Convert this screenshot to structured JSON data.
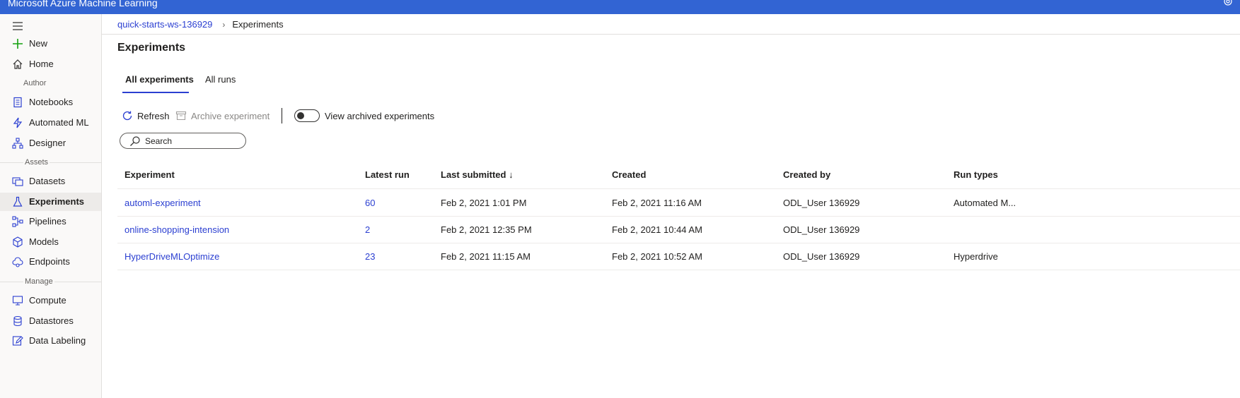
{
  "app": {
    "title": "Microsoft Azure Machine Learning"
  },
  "sidebar": {
    "top_items": [
      {
        "label": "New",
        "icon": "plus-icon"
      },
      {
        "label": "Home",
        "icon": "home-icon"
      }
    ],
    "sections": [
      {
        "label": "Author",
        "items": [
          {
            "label": "Notebooks",
            "icon": "notebook-icon"
          },
          {
            "label": "Automated ML",
            "icon": "automated-ml-icon"
          },
          {
            "label": "Designer",
            "icon": "designer-icon"
          }
        ]
      },
      {
        "label": "Assets",
        "items": [
          {
            "label": "Datasets",
            "icon": "datasets-icon"
          },
          {
            "label": "Experiments",
            "icon": "flask-icon",
            "active": true
          },
          {
            "label": "Pipelines",
            "icon": "pipelines-icon"
          },
          {
            "label": "Models",
            "icon": "cube-icon"
          },
          {
            "label": "Endpoints",
            "icon": "cloud-icon"
          }
        ]
      },
      {
        "label": "Manage",
        "items": [
          {
            "label": "Compute",
            "icon": "monitor-icon"
          },
          {
            "label": "Datastores",
            "icon": "database-icon"
          },
          {
            "label": "Data Labeling",
            "icon": "edit-icon"
          }
        ]
      }
    ]
  },
  "breadcrumb": {
    "workspace": "quick-starts-ws-136929",
    "current": "Experiments"
  },
  "page": {
    "title": "Experiments"
  },
  "tabs": [
    {
      "label": "All experiments",
      "active": true
    },
    {
      "label": "All runs",
      "active": false
    }
  ],
  "toolbar": {
    "refresh_label": "Refresh",
    "archive_label": "Archive experiment",
    "toggle_label": "View archived experiments",
    "toggle_on": false
  },
  "search": {
    "placeholder": "Search"
  },
  "table": {
    "columns": [
      "Experiment",
      "Latest run",
      "Last submitted ↓",
      "Created",
      "Created by",
      "Run types"
    ],
    "rows": [
      {
        "experiment": "automl-experiment",
        "latest_run": "60",
        "last_submitted": "Feb 2, 2021 1:01 PM",
        "created": "Feb 2, 2021 11:16 AM",
        "created_by": "ODL_User 136929",
        "run_types": "Automated M..."
      },
      {
        "experiment": "online-shopping-intension",
        "latest_run": "2",
        "last_submitted": "Feb 2, 2021 12:35 PM",
        "created": "Feb 2, 2021 10:44 AM",
        "created_by": "ODL_User 136929",
        "run_types": ""
      },
      {
        "experiment": "HyperDriveMLOptimize",
        "latest_run": "23",
        "last_submitted": "Feb 2, 2021 11:15 AM",
        "created": "Feb 2, 2021 10:52 AM",
        "created_by": "ODL_User 136929",
        "run_types": "Hyperdrive"
      }
    ]
  },
  "colors": {
    "topbar": "#3264d3",
    "link": "#2b3fd1",
    "new_plus": "#13a10e"
  }
}
